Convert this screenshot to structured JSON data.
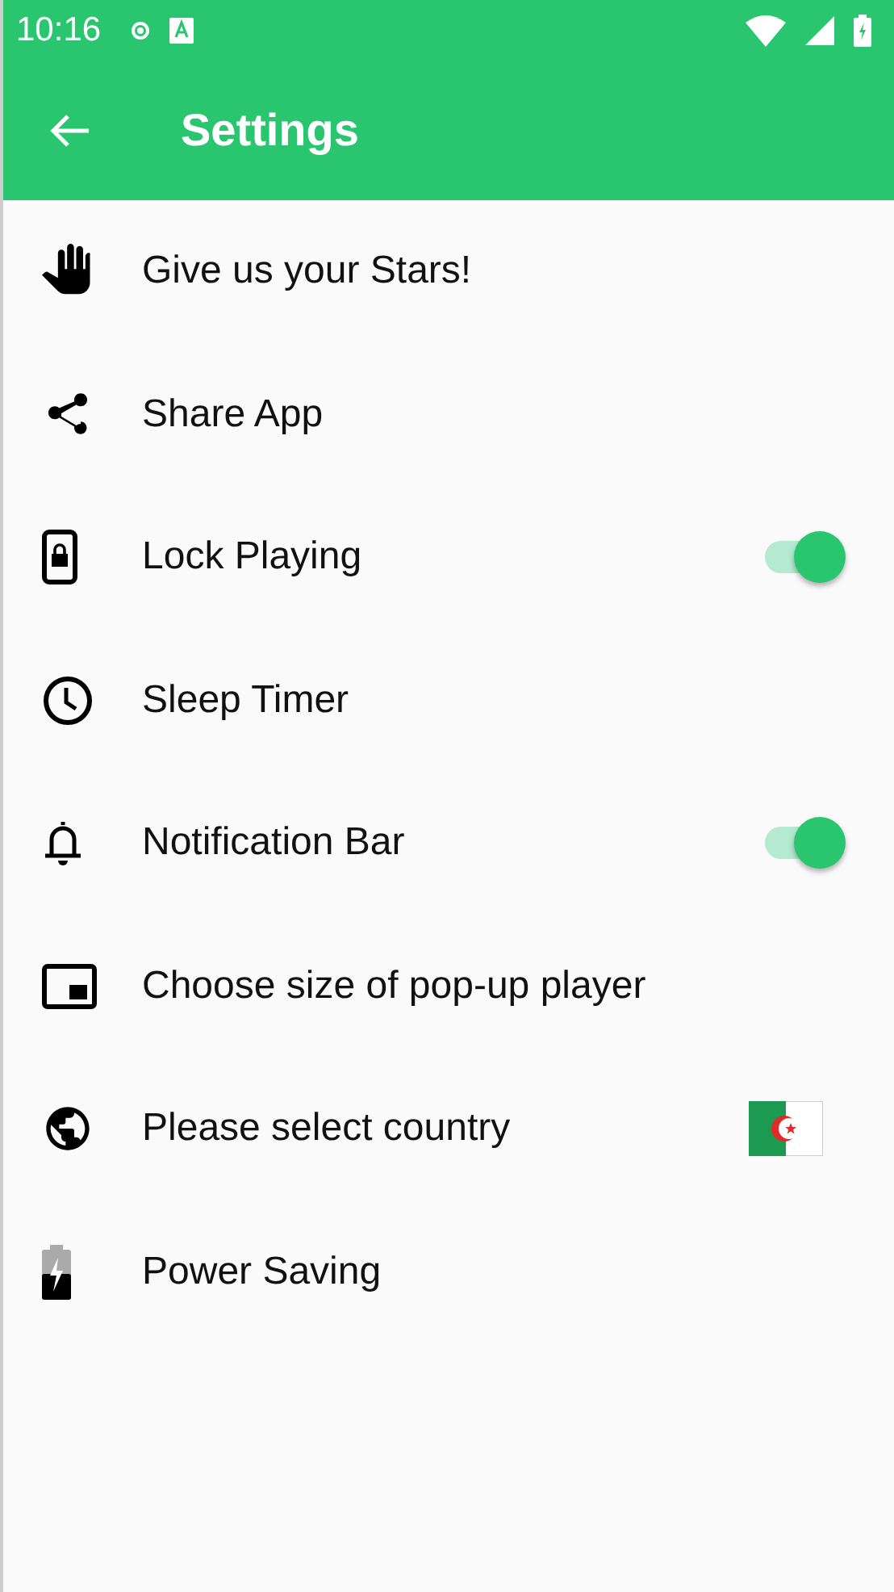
{
  "status_bar": {
    "time": "10:16"
  },
  "app_bar": {
    "title": "Settings"
  },
  "items": [
    {
      "label": "Give us your Stars!",
      "kind": "plain"
    },
    {
      "label": "Share App",
      "kind": "plain"
    },
    {
      "label": "Lock Playing",
      "kind": "switch",
      "on": true
    },
    {
      "label": "Sleep Timer",
      "kind": "plain"
    },
    {
      "label": "Notification Bar",
      "kind": "switch",
      "on": true
    },
    {
      "label": "Choose size of pop-up player",
      "kind": "plain"
    },
    {
      "label": "Please select country",
      "kind": "flag"
    },
    {
      "label": "Power Saving",
      "kind": "plain"
    }
  ]
}
